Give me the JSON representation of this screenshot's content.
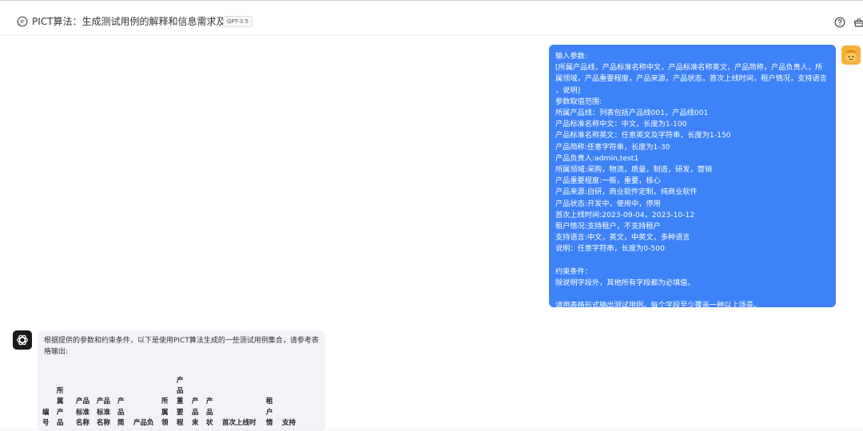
{
  "header": {
    "title": "PICT算法：生成测试用例的解释和信息需求及例子",
    "model_badge": "GPT-3.5"
  },
  "user_message": {
    "lines": [
      "输入参数:",
      "[所属产品线，产品标准名称中文，产品标准名称英文，产品简称，产品负责人，所",
      "属领域，产品重要程度，产品来源，产品状态，首次上线时间，租户情况，支持语言",
      "，说明]",
      "参数取值范围:",
      "所属产品线：列表包括产品线001，产品线001",
      "产品标准名称中文：中文，长度为1-100",
      "产品标准名称英文：任意英文及字符串，长度为1-150",
      "产品简称:任意字符串，长度为1-30",
      "产品负责人:admin,test1",
      "所属领域:采购，物流，质量，制造，研发，营销",
      "产品重要程度:一般，重要，核心",
      "产品来源:自研，商业软件定制，纯商业软件",
      "产品状态:开发中，使用中，停用",
      "首次上线时间:2023-09-04，2023-10-12",
      "租户情况:支持租户，不支持租户",
      "支持语言:中文，英文，中英文，多种语言",
      "说明：任意字符串，长度为0-500",
      "",
      "约束条件：",
      "除说明字段外，其他所有字段都为必填值。",
      "",
      "请用表格形式输出测试用例。每个字段至少覆盖一种以上场景。"
    ]
  },
  "ai_message": {
    "intro": "根据提供的参数和约束条件，以下是使用PICT算法生成的一些测试用例集合，请参考表格输出:",
    "table_headers": [
      "编号",
      "所属产品",
      "产品标准名称",
      "产品标准名称",
      "产品简",
      "产品负",
      "所属领",
      "产品重要程",
      "产品来",
      "产品状",
      "首次上线时",
      "租户情",
      "支持"
    ]
  },
  "icons": {
    "chat": "chat-bubble-icon",
    "help": "question-circle-icon",
    "shop": "basket-icon",
    "ai_avatar": "openai-logo-icon",
    "user_avatar": "user-avatar-icon"
  },
  "colors": {
    "user_bubble": "#3d82f7",
    "ai_bubble": "#f1f3f8",
    "user_avatar": "#f6b03a",
    "ai_avatar": "#1a1a1a"
  }
}
